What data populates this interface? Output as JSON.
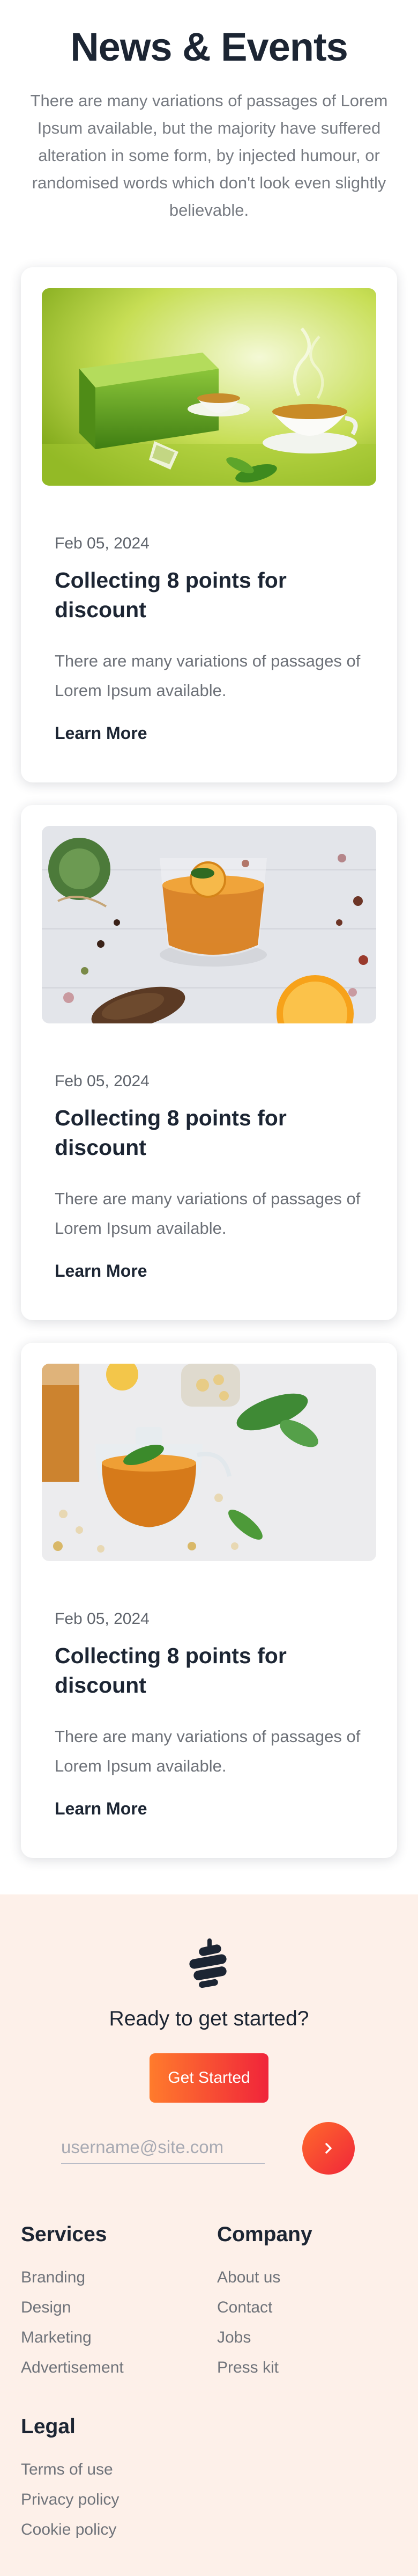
{
  "news": {
    "title": "News & Events",
    "description": "There are many variations of passages of Lorem Ipsum available, but the majority have suffered alteration in some form, by injected humour, or randomised words which don't look even slightly believable."
  },
  "cards": [
    {
      "image": "green-tea-box-image",
      "date": "Feb 05, 2024",
      "title": "Collecting 8 points for discount",
      "text": "There are many variations of passages of Lorem Ipsum available.",
      "link": "Learn More"
    },
    {
      "image": "orange-tea-glass-image",
      "date": "Feb 05, 2024",
      "title": "Collecting 8 points for discount",
      "text": "There are many variations of passages of Lorem Ipsum available.",
      "link": "Learn More"
    },
    {
      "image": "herbal-tea-teapot-image",
      "date": "Feb 05, 2024",
      "title": "Collecting 8 points for discount",
      "text": "There are many variations of passages of Lorem Ipsum available.",
      "link": "Learn More"
    }
  ],
  "footer": {
    "logo_icon": "brand-logo-icon",
    "cta_heading": "Ready to get started?",
    "cta_button": "Get Started",
    "email_placeholder": "username@site.com",
    "send_icon": "chevron-right-icon",
    "services": {
      "heading": "Services",
      "links": [
        "Branding",
        "Design",
        "Marketing",
        "Advertisement"
      ]
    },
    "company": {
      "heading": "Company",
      "links": [
        "About us",
        "Contact",
        "Jobs",
        "Press kit"
      ]
    },
    "legal": {
      "heading": "Legal",
      "links": [
        "Terms of use",
        "Privacy policy",
        "Cookie policy"
      ]
    }
  },
  "colors": {
    "accent_start": "#ff7b2c",
    "accent_end": "#f0243a",
    "footer_bg": "#fdf0e9",
    "heading": "#1c2533",
    "body_text": "#6d7178"
  }
}
